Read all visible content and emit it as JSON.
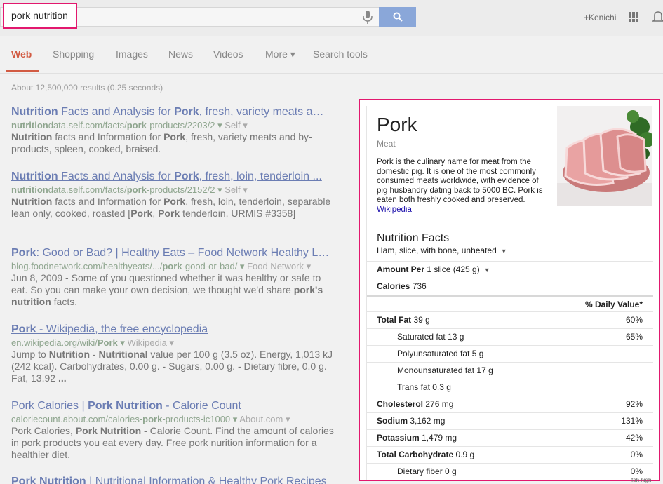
{
  "search": {
    "query": "pork nutrition"
  },
  "header": {
    "user": "+Kenichi"
  },
  "tabs": [
    {
      "label": "Web",
      "active": true
    },
    {
      "label": "Shopping"
    },
    {
      "label": "Images"
    },
    {
      "label": "News"
    },
    {
      "label": "Videos"
    },
    {
      "label": "More ▾"
    },
    {
      "label": "Search tools"
    }
  ],
  "stats": "About 12,500,000 results (0.25 seconds)",
  "results": [
    {
      "title_parts": [
        [
          "b",
          "Nutrition"
        ],
        [
          "t",
          " Facts and Analysis for "
        ],
        [
          "b",
          "Pork"
        ],
        [
          "t",
          ", fresh, variety meats a…"
        ]
      ],
      "url_parts": [
        [
          "b",
          "nutrition"
        ],
        [
          "t",
          "data.self.com/facts/"
        ],
        [
          "b",
          "pork"
        ],
        [
          "t",
          "-products/2203/2 ▾ "
        ],
        [
          "x",
          "Self ▾"
        ]
      ],
      "snippet_parts": [
        [
          "b",
          "Nutrition"
        ],
        [
          "t",
          " facts and Information for "
        ],
        [
          "b",
          "Pork"
        ],
        [
          "t",
          ", fresh, variety meats and by-products, spleen, cooked, braised."
        ]
      ]
    },
    {
      "title_parts": [
        [
          "b",
          "Nutrition"
        ],
        [
          "t",
          " Facts and Analysis for "
        ],
        [
          "b",
          "Pork"
        ],
        [
          "t",
          ", fresh, loin, tenderloin ..."
        ]
      ],
      "url_parts": [
        [
          "b",
          "nutrition"
        ],
        [
          "t",
          "data.self.com/facts/"
        ],
        [
          "b",
          "pork"
        ],
        [
          "t",
          "-products/2152/2 ▾ "
        ],
        [
          "x",
          "Self ▾"
        ]
      ],
      "snippet_parts": [
        [
          "b",
          "Nutrition"
        ],
        [
          "t",
          " facts and Information for "
        ],
        [
          "b",
          "Pork"
        ],
        [
          "t",
          ", fresh, loin, tenderloin, separable lean only, cooked, roasted ["
        ],
        [
          "b",
          "Pork"
        ],
        [
          "t",
          ", "
        ],
        [
          "b",
          "Pork"
        ],
        [
          "t",
          " tenderloin, URMIS #3358]"
        ]
      ]
    },
    {
      "title_parts": [
        [
          "b",
          "Pork"
        ],
        [
          "t",
          ": Good or Bad? | Healthy Eats – Food Network Healthy L…"
        ]
      ],
      "url_parts": [
        [
          "t",
          "blog.foodnetwork.com/healthyeats/.../"
        ],
        [
          "b",
          "pork"
        ],
        [
          "t",
          "-good-or-bad/ ▾ "
        ],
        [
          "x",
          "Food Network ▾"
        ]
      ],
      "snippet_parts": [
        [
          "t",
          "Jun 8, 2009 - Some of you questioned whether it was healthy or safe to eat. So you can make your own decision, we thought we'd share "
        ],
        [
          "b",
          "pork's nutrition"
        ],
        [
          "t",
          " facts."
        ]
      ]
    },
    {
      "title_parts": [
        [
          "b",
          "Pork"
        ],
        [
          "t",
          " - Wikipedia, the free encyclopedia"
        ]
      ],
      "url_parts": [
        [
          "t",
          "en.wikipedia.org/wiki/"
        ],
        [
          "b",
          "Pork"
        ],
        [
          "t",
          " ▾ "
        ],
        [
          "x",
          "Wikipedia ▾"
        ]
      ],
      "snippet_parts": [
        [
          "t",
          "Jump to "
        ],
        [
          "b",
          "Nutrition"
        ],
        [
          "t",
          " - "
        ],
        [
          "b",
          "Nutritional"
        ],
        [
          "t",
          " value per 100 g (3.5 oz). Energy, 1,013 kJ (242 kcal). Carbohydrates, 0.00 g. - Sugars, 0.00 g. - Dietary fibre, 0.0 g. Fat, 13.92 "
        ],
        [
          "b",
          "..."
        ]
      ]
    },
    {
      "title_parts": [
        [
          "t",
          "Pork Calories | "
        ],
        [
          "b",
          "Pork Nutrition"
        ],
        [
          "t",
          " - Calorie Count"
        ]
      ],
      "url_parts": [
        [
          "t",
          "caloriecount.about.com/calories-"
        ],
        [
          "b",
          "pork"
        ],
        [
          "t",
          "-products-ic1000 ▾ "
        ],
        [
          "x",
          "About.com ▾"
        ]
      ],
      "snippet_parts": [
        [
          "t",
          "Pork Calories, "
        ],
        [
          "b",
          "Pork Nutrition"
        ],
        [
          "t",
          " - Calorie Count. Find the amount of calories in pork products you eat every day. Free pork nurition information for a healthier diet."
        ]
      ]
    },
    {
      "title_parts": [
        [
          "b",
          "Pork Nutrition"
        ],
        [
          "t",
          " | Nutritional Information & Healthy Pork Recipes"
        ]
      ],
      "url_parts": [],
      "snippet_parts": []
    }
  ],
  "knowledge_panel": {
    "title": "Pork",
    "type": "Meat",
    "description": "Pork is the culinary name for meat from the domestic pig. It is one of the most commonly consumed meats worldwide, with evidence of pig husbandry dating back to 5000 BC. Pork is eaten both freshly cooked and preserved.",
    "source": "Wikipedia",
    "nutrition": {
      "title": "Nutrition Facts",
      "serving": "Ham, slice, with bone, unheated",
      "amount_label": "Amount Per",
      "amount_value": "1 slice (425 g)",
      "calories_label": "Calories",
      "calories_value": "736",
      "dv_header": "% Daily Value*",
      "rows": [
        {
          "label": "Total Fat",
          "value": "39 g",
          "pct": "60%",
          "sub": false,
          "bold": true
        },
        {
          "label": "Saturated fat",
          "value": "13 g",
          "pct": "65%",
          "sub": true,
          "bold": false
        },
        {
          "label": "Polyunsaturated fat",
          "value": "5 g",
          "pct": "",
          "sub": true,
          "bold": false
        },
        {
          "label": "Monounsaturated fat",
          "value": "17 g",
          "pct": "",
          "sub": true,
          "bold": false
        },
        {
          "label": "Trans fat",
          "value": "0.3 g",
          "pct": "",
          "sub": true,
          "bold": false
        },
        {
          "label": "Cholesterol",
          "value": "276 mg",
          "pct": "92%",
          "sub": false,
          "bold": true
        },
        {
          "label": "Sodium",
          "value": "3,162 mg",
          "pct": "131%",
          "sub": false,
          "bold": true
        },
        {
          "label": "Potassium",
          "value": "1,479 mg",
          "pct": "42%",
          "sub": false,
          "bold": true
        },
        {
          "label": "Total Carbohydrate",
          "value": "0.9 g",
          "pct": "0%",
          "sub": false,
          "bold": true
        },
        {
          "label": "Dietary fiber",
          "value": "0 g",
          "pct": "0%",
          "sub": true,
          "bold": false
        }
      ]
    }
  },
  "corner_note": "fah high",
  "colors": {
    "accent": "#d25b43",
    "highlight": "#e2186e",
    "search_button": "#8aa7d9",
    "link": "#6b7db3"
  }
}
